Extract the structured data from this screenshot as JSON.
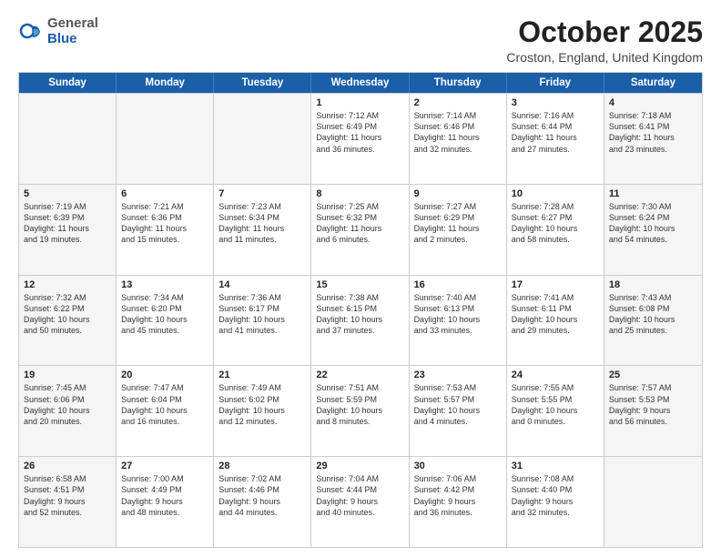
{
  "header": {
    "logo_line1": "General",
    "logo_line2": "Blue",
    "month_title": "October 2025",
    "location": "Croston, England, United Kingdom"
  },
  "days_of_week": [
    "Sunday",
    "Monday",
    "Tuesday",
    "Wednesday",
    "Thursday",
    "Friday",
    "Saturday"
  ],
  "weeks": [
    [
      {
        "day": "",
        "info": "",
        "shaded": true
      },
      {
        "day": "",
        "info": "",
        "shaded": true
      },
      {
        "day": "",
        "info": "",
        "shaded": true
      },
      {
        "day": "1",
        "info": "Sunrise: 7:12 AM\nSunset: 6:49 PM\nDaylight: 11 hours\nand 36 minutes.",
        "shaded": false
      },
      {
        "day": "2",
        "info": "Sunrise: 7:14 AM\nSunset: 6:46 PM\nDaylight: 11 hours\nand 32 minutes.",
        "shaded": false
      },
      {
        "day": "3",
        "info": "Sunrise: 7:16 AM\nSunset: 6:44 PM\nDaylight: 11 hours\nand 27 minutes.",
        "shaded": false
      },
      {
        "day": "4",
        "info": "Sunrise: 7:18 AM\nSunset: 6:41 PM\nDaylight: 11 hours\nand 23 minutes.",
        "shaded": true
      }
    ],
    [
      {
        "day": "5",
        "info": "Sunrise: 7:19 AM\nSunset: 6:39 PM\nDaylight: 11 hours\nand 19 minutes.",
        "shaded": true
      },
      {
        "day": "6",
        "info": "Sunrise: 7:21 AM\nSunset: 6:36 PM\nDaylight: 11 hours\nand 15 minutes.",
        "shaded": false
      },
      {
        "day": "7",
        "info": "Sunrise: 7:23 AM\nSunset: 6:34 PM\nDaylight: 11 hours\nand 11 minutes.",
        "shaded": false
      },
      {
        "day": "8",
        "info": "Sunrise: 7:25 AM\nSunset: 6:32 PM\nDaylight: 11 hours\nand 6 minutes.",
        "shaded": false
      },
      {
        "day": "9",
        "info": "Sunrise: 7:27 AM\nSunset: 6:29 PM\nDaylight: 11 hours\nand 2 minutes.",
        "shaded": false
      },
      {
        "day": "10",
        "info": "Sunrise: 7:28 AM\nSunset: 6:27 PM\nDaylight: 10 hours\nand 58 minutes.",
        "shaded": false
      },
      {
        "day": "11",
        "info": "Sunrise: 7:30 AM\nSunset: 6:24 PM\nDaylight: 10 hours\nand 54 minutes.",
        "shaded": true
      }
    ],
    [
      {
        "day": "12",
        "info": "Sunrise: 7:32 AM\nSunset: 6:22 PM\nDaylight: 10 hours\nand 50 minutes.",
        "shaded": true
      },
      {
        "day": "13",
        "info": "Sunrise: 7:34 AM\nSunset: 6:20 PM\nDaylight: 10 hours\nand 45 minutes.",
        "shaded": false
      },
      {
        "day": "14",
        "info": "Sunrise: 7:36 AM\nSunset: 6:17 PM\nDaylight: 10 hours\nand 41 minutes.",
        "shaded": false
      },
      {
        "day": "15",
        "info": "Sunrise: 7:38 AM\nSunset: 6:15 PM\nDaylight: 10 hours\nand 37 minutes.",
        "shaded": false
      },
      {
        "day": "16",
        "info": "Sunrise: 7:40 AM\nSunset: 6:13 PM\nDaylight: 10 hours\nand 33 minutes.",
        "shaded": false
      },
      {
        "day": "17",
        "info": "Sunrise: 7:41 AM\nSunset: 6:11 PM\nDaylight: 10 hours\nand 29 minutes.",
        "shaded": false
      },
      {
        "day": "18",
        "info": "Sunrise: 7:43 AM\nSunset: 6:08 PM\nDaylight: 10 hours\nand 25 minutes.",
        "shaded": true
      }
    ],
    [
      {
        "day": "19",
        "info": "Sunrise: 7:45 AM\nSunset: 6:06 PM\nDaylight: 10 hours\nand 20 minutes.",
        "shaded": true
      },
      {
        "day": "20",
        "info": "Sunrise: 7:47 AM\nSunset: 6:04 PM\nDaylight: 10 hours\nand 16 minutes.",
        "shaded": false
      },
      {
        "day": "21",
        "info": "Sunrise: 7:49 AM\nSunset: 6:02 PM\nDaylight: 10 hours\nand 12 minutes.",
        "shaded": false
      },
      {
        "day": "22",
        "info": "Sunrise: 7:51 AM\nSunset: 5:59 PM\nDaylight: 10 hours\nand 8 minutes.",
        "shaded": false
      },
      {
        "day": "23",
        "info": "Sunrise: 7:53 AM\nSunset: 5:57 PM\nDaylight: 10 hours\nand 4 minutes.",
        "shaded": false
      },
      {
        "day": "24",
        "info": "Sunrise: 7:55 AM\nSunset: 5:55 PM\nDaylight: 10 hours\nand 0 minutes.",
        "shaded": false
      },
      {
        "day": "25",
        "info": "Sunrise: 7:57 AM\nSunset: 5:53 PM\nDaylight: 9 hours\nand 56 minutes.",
        "shaded": true
      }
    ],
    [
      {
        "day": "26",
        "info": "Sunrise: 6:58 AM\nSunset: 4:51 PM\nDaylight: 9 hours\nand 52 minutes.",
        "shaded": true
      },
      {
        "day": "27",
        "info": "Sunrise: 7:00 AM\nSunset: 4:49 PM\nDaylight: 9 hours\nand 48 minutes.",
        "shaded": false
      },
      {
        "day": "28",
        "info": "Sunrise: 7:02 AM\nSunset: 4:46 PM\nDaylight: 9 hours\nand 44 minutes.",
        "shaded": false
      },
      {
        "day": "29",
        "info": "Sunrise: 7:04 AM\nSunset: 4:44 PM\nDaylight: 9 hours\nand 40 minutes.",
        "shaded": false
      },
      {
        "day": "30",
        "info": "Sunrise: 7:06 AM\nSunset: 4:42 PM\nDaylight: 9 hours\nand 36 minutes.",
        "shaded": false
      },
      {
        "day": "31",
        "info": "Sunrise: 7:08 AM\nSunset: 4:40 PM\nDaylight: 9 hours\nand 32 minutes.",
        "shaded": false
      },
      {
        "day": "",
        "info": "",
        "shaded": true
      }
    ]
  ]
}
